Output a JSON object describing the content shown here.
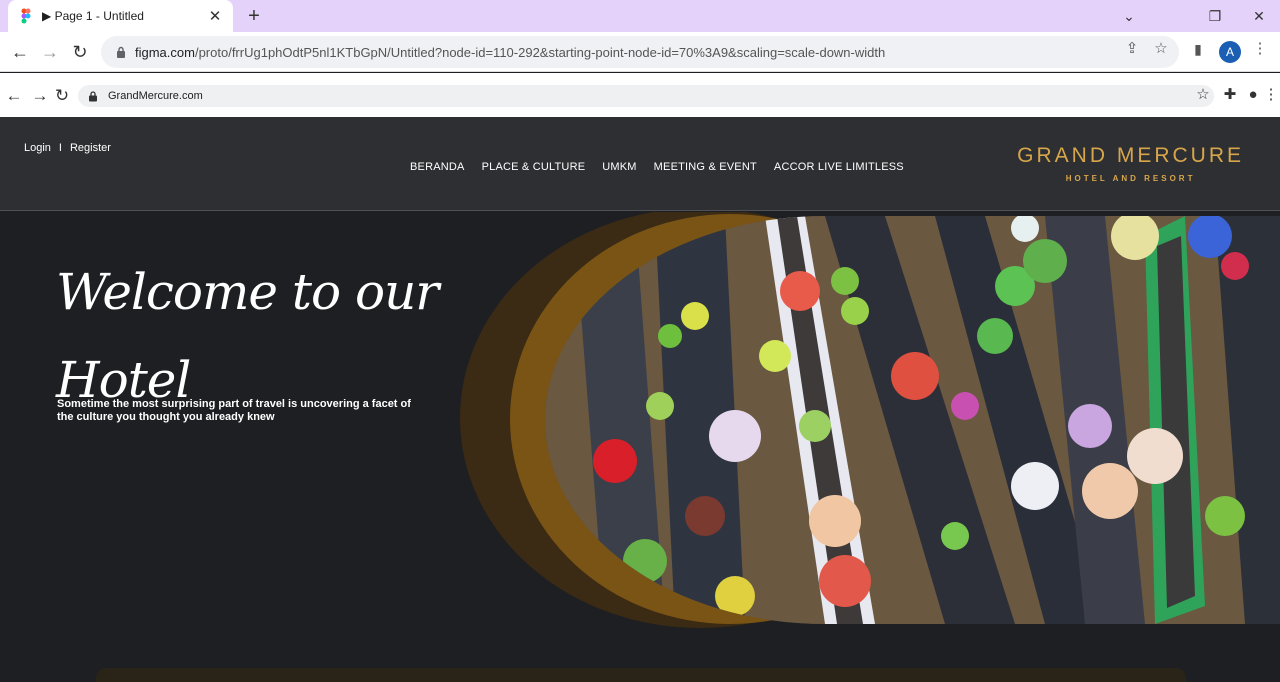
{
  "browser": {
    "tab_title": "▶ Page 1 - Untitled",
    "url_host": "figma.com",
    "url_path": "/proto/frrUg1phOdtP5nl1KTbGpN/Untitled?node-id=110-292&starting-point-node-id=70%3A9&scaling=scale-down-width",
    "profile_initial": "A"
  },
  "inner_browser": {
    "url": "GrandMercure.com"
  },
  "header": {
    "login": "Login",
    "separator": "I",
    "register": "Register",
    "nav": [
      "BERANDA",
      "PLACE & CULTURE",
      "UMKM",
      "MEETING & EVENT",
      "ACCOR LIVE LIMITLESS"
    ],
    "brand_name": "GRAND MERCURE",
    "brand_tag": "HOTEL AND RESORT"
  },
  "hero": {
    "welcome_line1": "Welcome to our",
    "welcome_line2": "Hotel",
    "subtitle": "Sometime the most surprising part of travel is uncovering a facet of the culture you thought you already knew"
  },
  "colors": {
    "header_bg": "#2e2f33",
    "page_bg": "#1e1f23",
    "gold": "#d7a64a",
    "tab_strip": "#e5d2fb"
  }
}
